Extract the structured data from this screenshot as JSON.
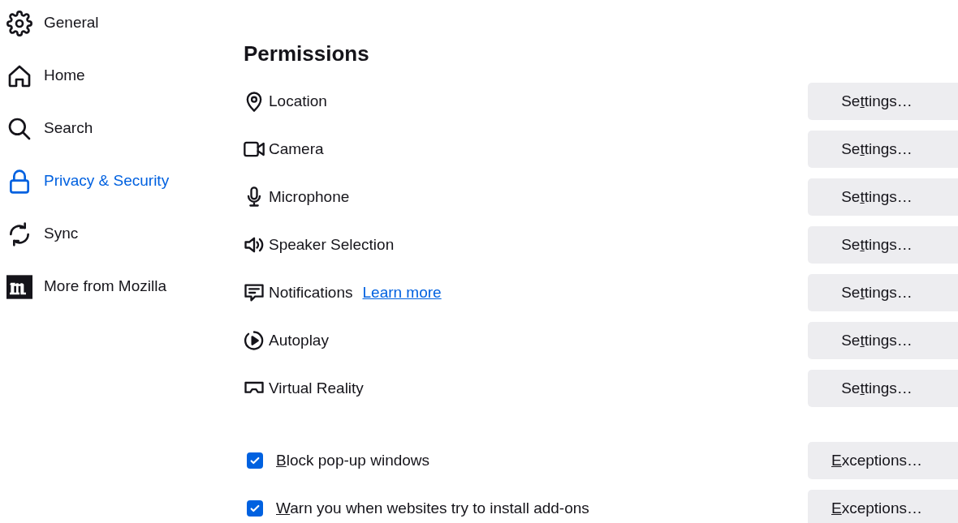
{
  "sidebar": {
    "items": [
      {
        "label": "General",
        "selected": false
      },
      {
        "label": "Home",
        "selected": false
      },
      {
        "label": "Search",
        "selected": false
      },
      {
        "label": "Privacy & Security",
        "selected": true
      },
      {
        "label": "Sync",
        "selected": false
      },
      {
        "label": "More from Mozilla",
        "selected": false
      }
    ]
  },
  "permissions": {
    "title": "Permissions",
    "rows": [
      {
        "kind": "setting",
        "label": "Location",
        "button": {
          "label_before": "Se",
          "accesskey": "t",
          "label_after": "tings…"
        }
      },
      {
        "kind": "setting",
        "label": "Camera",
        "button": {
          "label_before": "Se",
          "accesskey": "t",
          "label_after": "tings…"
        }
      },
      {
        "kind": "setting",
        "label": "Microphone",
        "button": {
          "label_before": "Se",
          "accesskey": "t",
          "label_after": "tings…"
        }
      },
      {
        "kind": "setting",
        "label": "Speaker Selection",
        "button": {
          "label_before": "Se",
          "accesskey": "t",
          "label_after": "tings…"
        }
      },
      {
        "kind": "setting",
        "label": "Notifications",
        "link": "Learn more",
        "button": {
          "label_before": "Se",
          "accesskey": "t",
          "label_after": "tings…"
        }
      },
      {
        "kind": "setting",
        "label": "Autoplay",
        "button": {
          "label_before": "Se",
          "accesskey": "t",
          "label_after": "tings…"
        }
      },
      {
        "kind": "setting",
        "label": "Virtual Reality",
        "button": {
          "label_before": "Se",
          "accesskey": "t",
          "label_after": "tings…"
        }
      },
      {
        "kind": "checkbox",
        "checked": true,
        "accesskey": "B",
        "label_after": "lock pop-up windows",
        "button": {
          "accesskey": "E",
          "label_after": "xceptions…"
        }
      },
      {
        "kind": "checkbox",
        "checked": true,
        "accesskey": "W",
        "label_after": "arn you when websites try to install add-ons",
        "button": {
          "accesskey": "E",
          "label_after": "xceptions…"
        }
      }
    ]
  }
}
